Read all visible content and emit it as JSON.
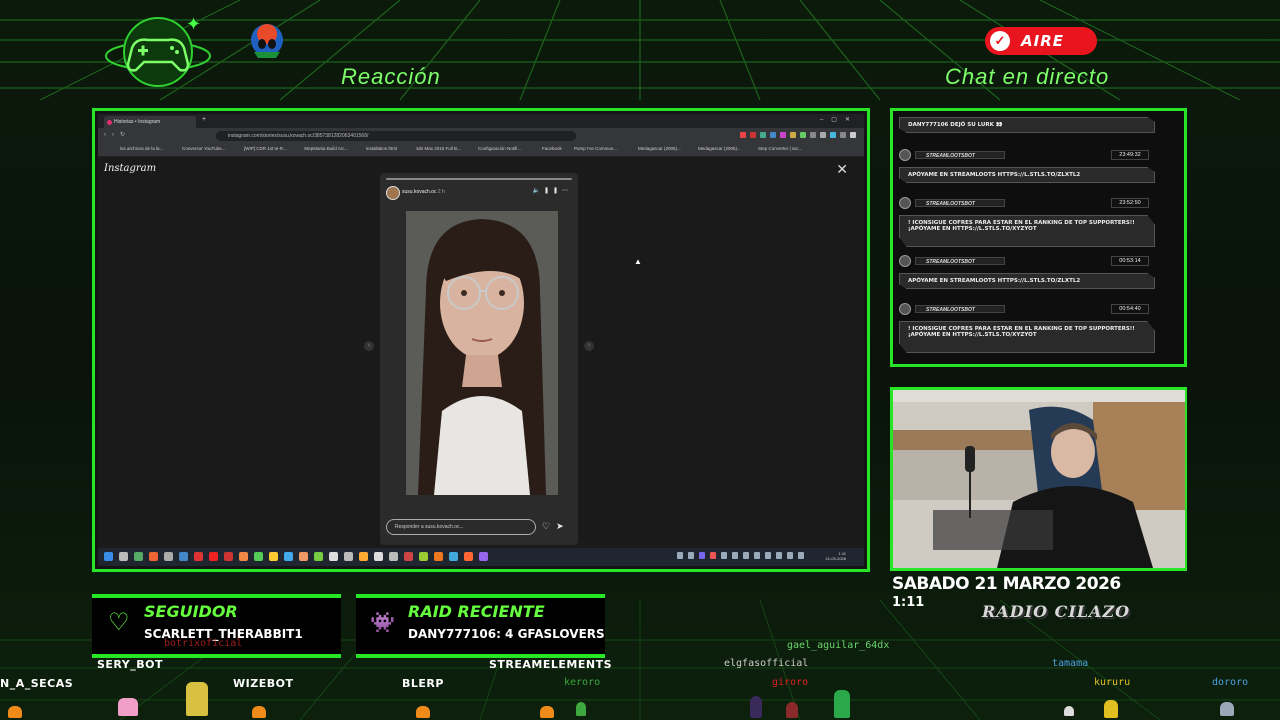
{
  "overlay": {
    "reaction_title": "Reacción",
    "chat_title": "Chat en directo",
    "live_badge": "AIRE",
    "date": "SABADO 21 MARZO 2026",
    "time": "1:11",
    "channel_name": "RADIO CILAZO",
    "colors": {
      "accent": "#26e626",
      "live": "#e8141e",
      "title": "#7dff6a"
    }
  },
  "browser": {
    "tab_title": "Historias • Instagram",
    "url": "instagram.com/stories/susu.kovach.oc/3857381282063401568/",
    "bookmarks": [
      "los archivos de la la...",
      "Conversor YouTube...",
      "[WIP] CDR 1st te-R...",
      "StepMania Build Arc...",
      "installation.html",
      "3ds Max 2016 Full B...",
      "Configuración Notifi...",
      "Facebook",
      "Pump I've Commun...",
      "Medagascar (2005)...",
      "Medagascar (2005)...",
      "Step Converter | ssc..."
    ],
    "site_logo": "Instagram",
    "story_user": "susu.kovach.oc",
    "story_age": "2 h",
    "reply_placeholder": "Responder a susu.kovach.oc...",
    "clock_time": "1:11",
    "clock_date": "21-03-2026"
  },
  "chat": {
    "top_message": "DANY777106 DEJÓ SU LURK 👀",
    "entries": [
      {
        "user": "STREAMLOOTSBOT",
        "time": "23:49:32",
        "text": "APÓYAME EN STREAMLOOTS HTTPS://L.STLS.TO/ZLXTL2"
      },
      {
        "user": "STREAMLOOTSBOT",
        "time": "23:52:50",
        "text": "! ICONSIGUE COFRES PARA ESTAR EN EL RANKING DE TOP SUPPORTERS!! ¡APÓYAME EN HTTPS://L.STLS.TO/XYZYOT"
      },
      {
        "user": "STREAMLOOTSBOT",
        "time": "00:53:14",
        "text": "APÓYAME EN STREAMLOOTS HTTPS://L.STLS.TO/ZLXTL2"
      },
      {
        "user": "STREAMLOOTSBOT",
        "time": "00:54:40",
        "text": "! ICONSIGUE COFRES PARA ESTAR EN EL RANKING DE TOP SUPPORTERS!! ¡APÓYAME EN HTTPS://L.STLS.TO/XYZYOT"
      }
    ]
  },
  "alerts": {
    "follower_title": "SEGUIDOR",
    "follower_value": "SCARLETT_THERABBIT1",
    "follower_sub": "botrixoficial",
    "raid_title": "RAID RECIENTE",
    "raid_value": "DANY777106: 4 GFASLOVERS"
  },
  "viewers": {
    "bold": [
      "SERY_BOT",
      "STREAMELEMENTS",
      "N_A_SECAS",
      "WIZEBOT",
      "BLERP"
    ],
    "pixel": [
      "gael_aguilar_64dx",
      "elgfasofficial",
      "tamama",
      "keroro",
      "giroro",
      "kururu",
      "dororo"
    ]
  }
}
